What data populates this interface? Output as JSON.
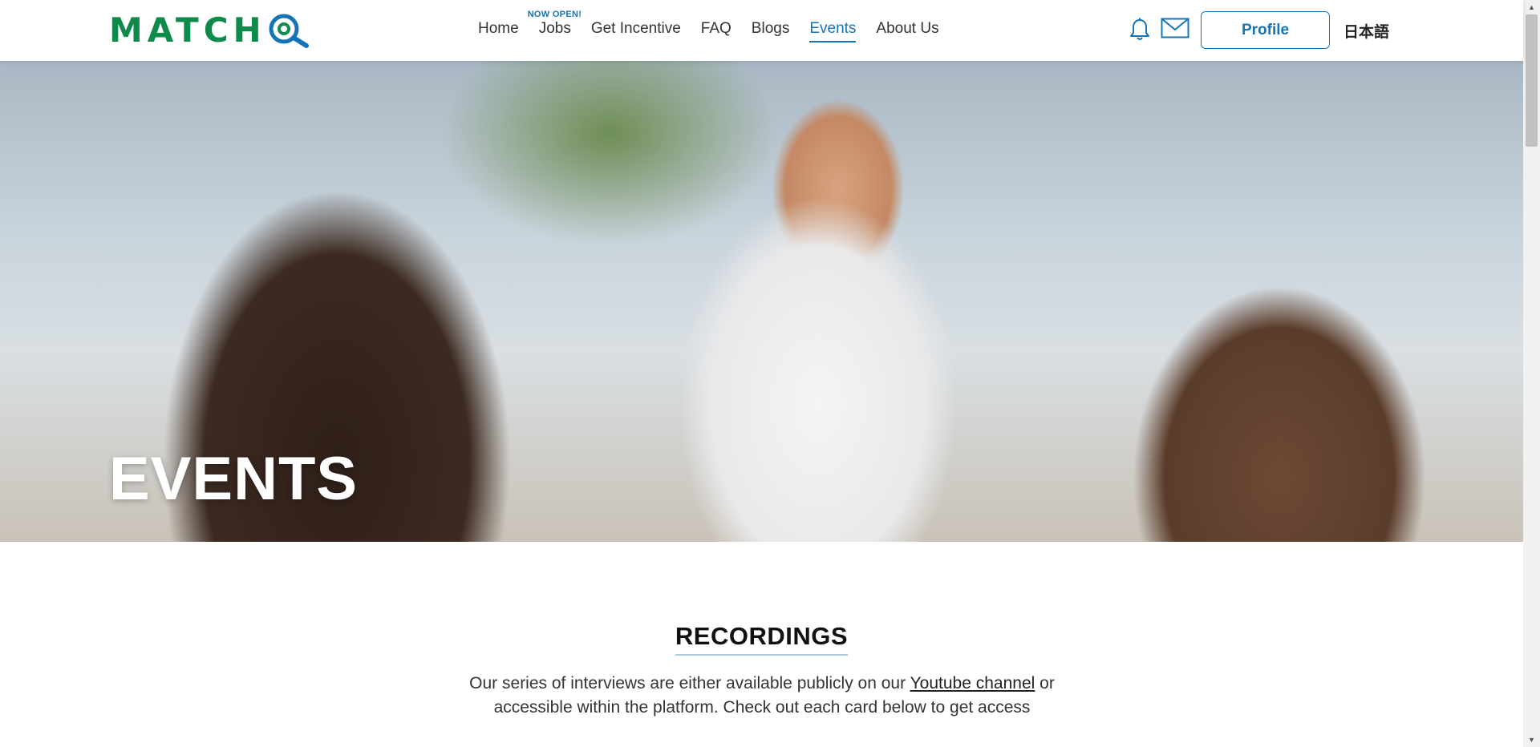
{
  "header": {
    "logo_text": "MATCH",
    "nav": [
      {
        "label": "Home",
        "active": false
      },
      {
        "label": "Jobs",
        "badge": "NOW OPEN!",
        "active": false
      },
      {
        "label": "Get Incentive",
        "active": false
      },
      {
        "label": "FAQ",
        "active": false
      },
      {
        "label": "Blogs",
        "active": false
      },
      {
        "label": "Events",
        "active": true
      },
      {
        "label": "About Us",
        "active": false
      }
    ],
    "profile_label": "Profile",
    "language_label": "日本語",
    "icons": [
      "bell-icon",
      "mail-icon"
    ]
  },
  "hero": {
    "title": "EVENTS"
  },
  "recordings": {
    "title": "RECORDINGS",
    "intro_before": "Our series of interviews are either available publicly on our",
    "intro_link": "Youtube channel",
    "intro_after": "or accessible within the platform. Check out each card below to get access"
  },
  "colors": {
    "brand_green": "#0e8a4a",
    "brand_blue": "#1574b8",
    "title_underline": "#a9cbe3"
  }
}
